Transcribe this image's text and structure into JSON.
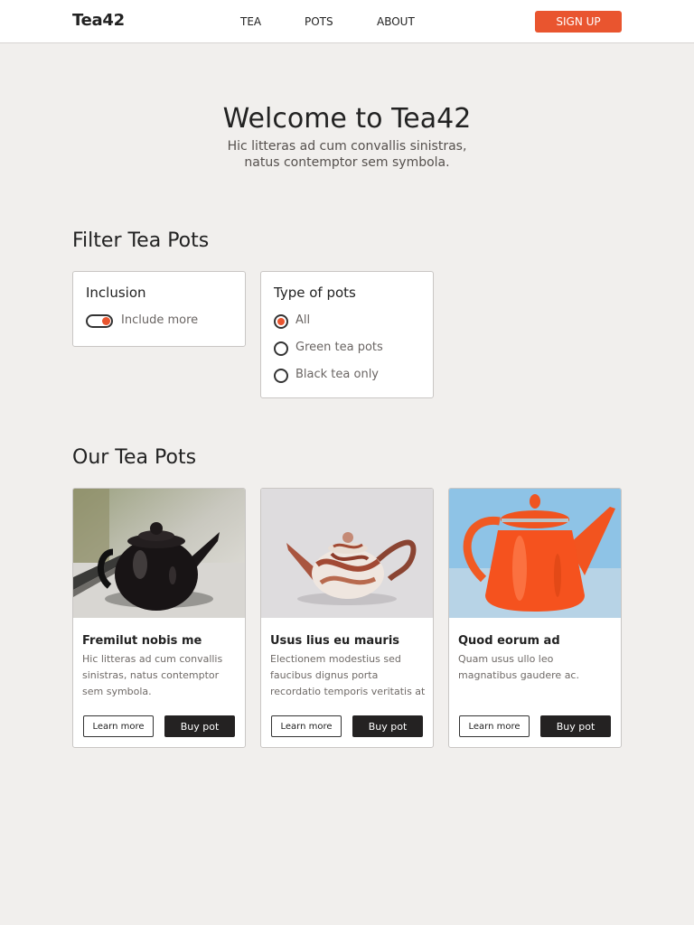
{
  "header": {
    "brand": "Tea42",
    "nav": [
      "TEA",
      "POTS",
      "ABOUT"
    ],
    "signup_label": "SIGN UP",
    "accent_color": "#e9552f"
  },
  "hero": {
    "title": "Welcome to Tea42",
    "subtitle": "Hic litteras ad cum convallis sinistras, natus contemptor sem symbola."
  },
  "filter": {
    "heading": "Filter Tea Pots",
    "inclusion": {
      "title": "Inclusion",
      "toggle_label": "Include more",
      "toggle_on": true
    },
    "type": {
      "title": "Type of pots",
      "options": [
        "All",
        "Green tea pots",
        "Black tea only"
      ],
      "selected": "All"
    }
  },
  "products": {
    "heading": "Our Tea Pots",
    "items": [
      {
        "title": "Fremilut nobis me",
        "description": "Hic litteras ad cum convallis sinistras, natus contemptor sem symbola.",
        "image": "black-teapot-image",
        "learn_label": "Learn more",
        "buy_label": "Buy pot"
      },
      {
        "title": "Usus lius eu mauris",
        "description": "Electionem modestius sed faucibus dignus porta recordatio temporis veritatis at",
        "image": "marbled-teapot-image",
        "learn_label": "Learn more",
        "buy_label": "Buy pot"
      },
      {
        "title": "Quod eorum ad",
        "description": "Quam usus ullo leo magnatibus gaudere ac.",
        "image": "orange-teapot-image",
        "learn_label": "Learn more",
        "buy_label": "Buy pot"
      }
    ]
  }
}
